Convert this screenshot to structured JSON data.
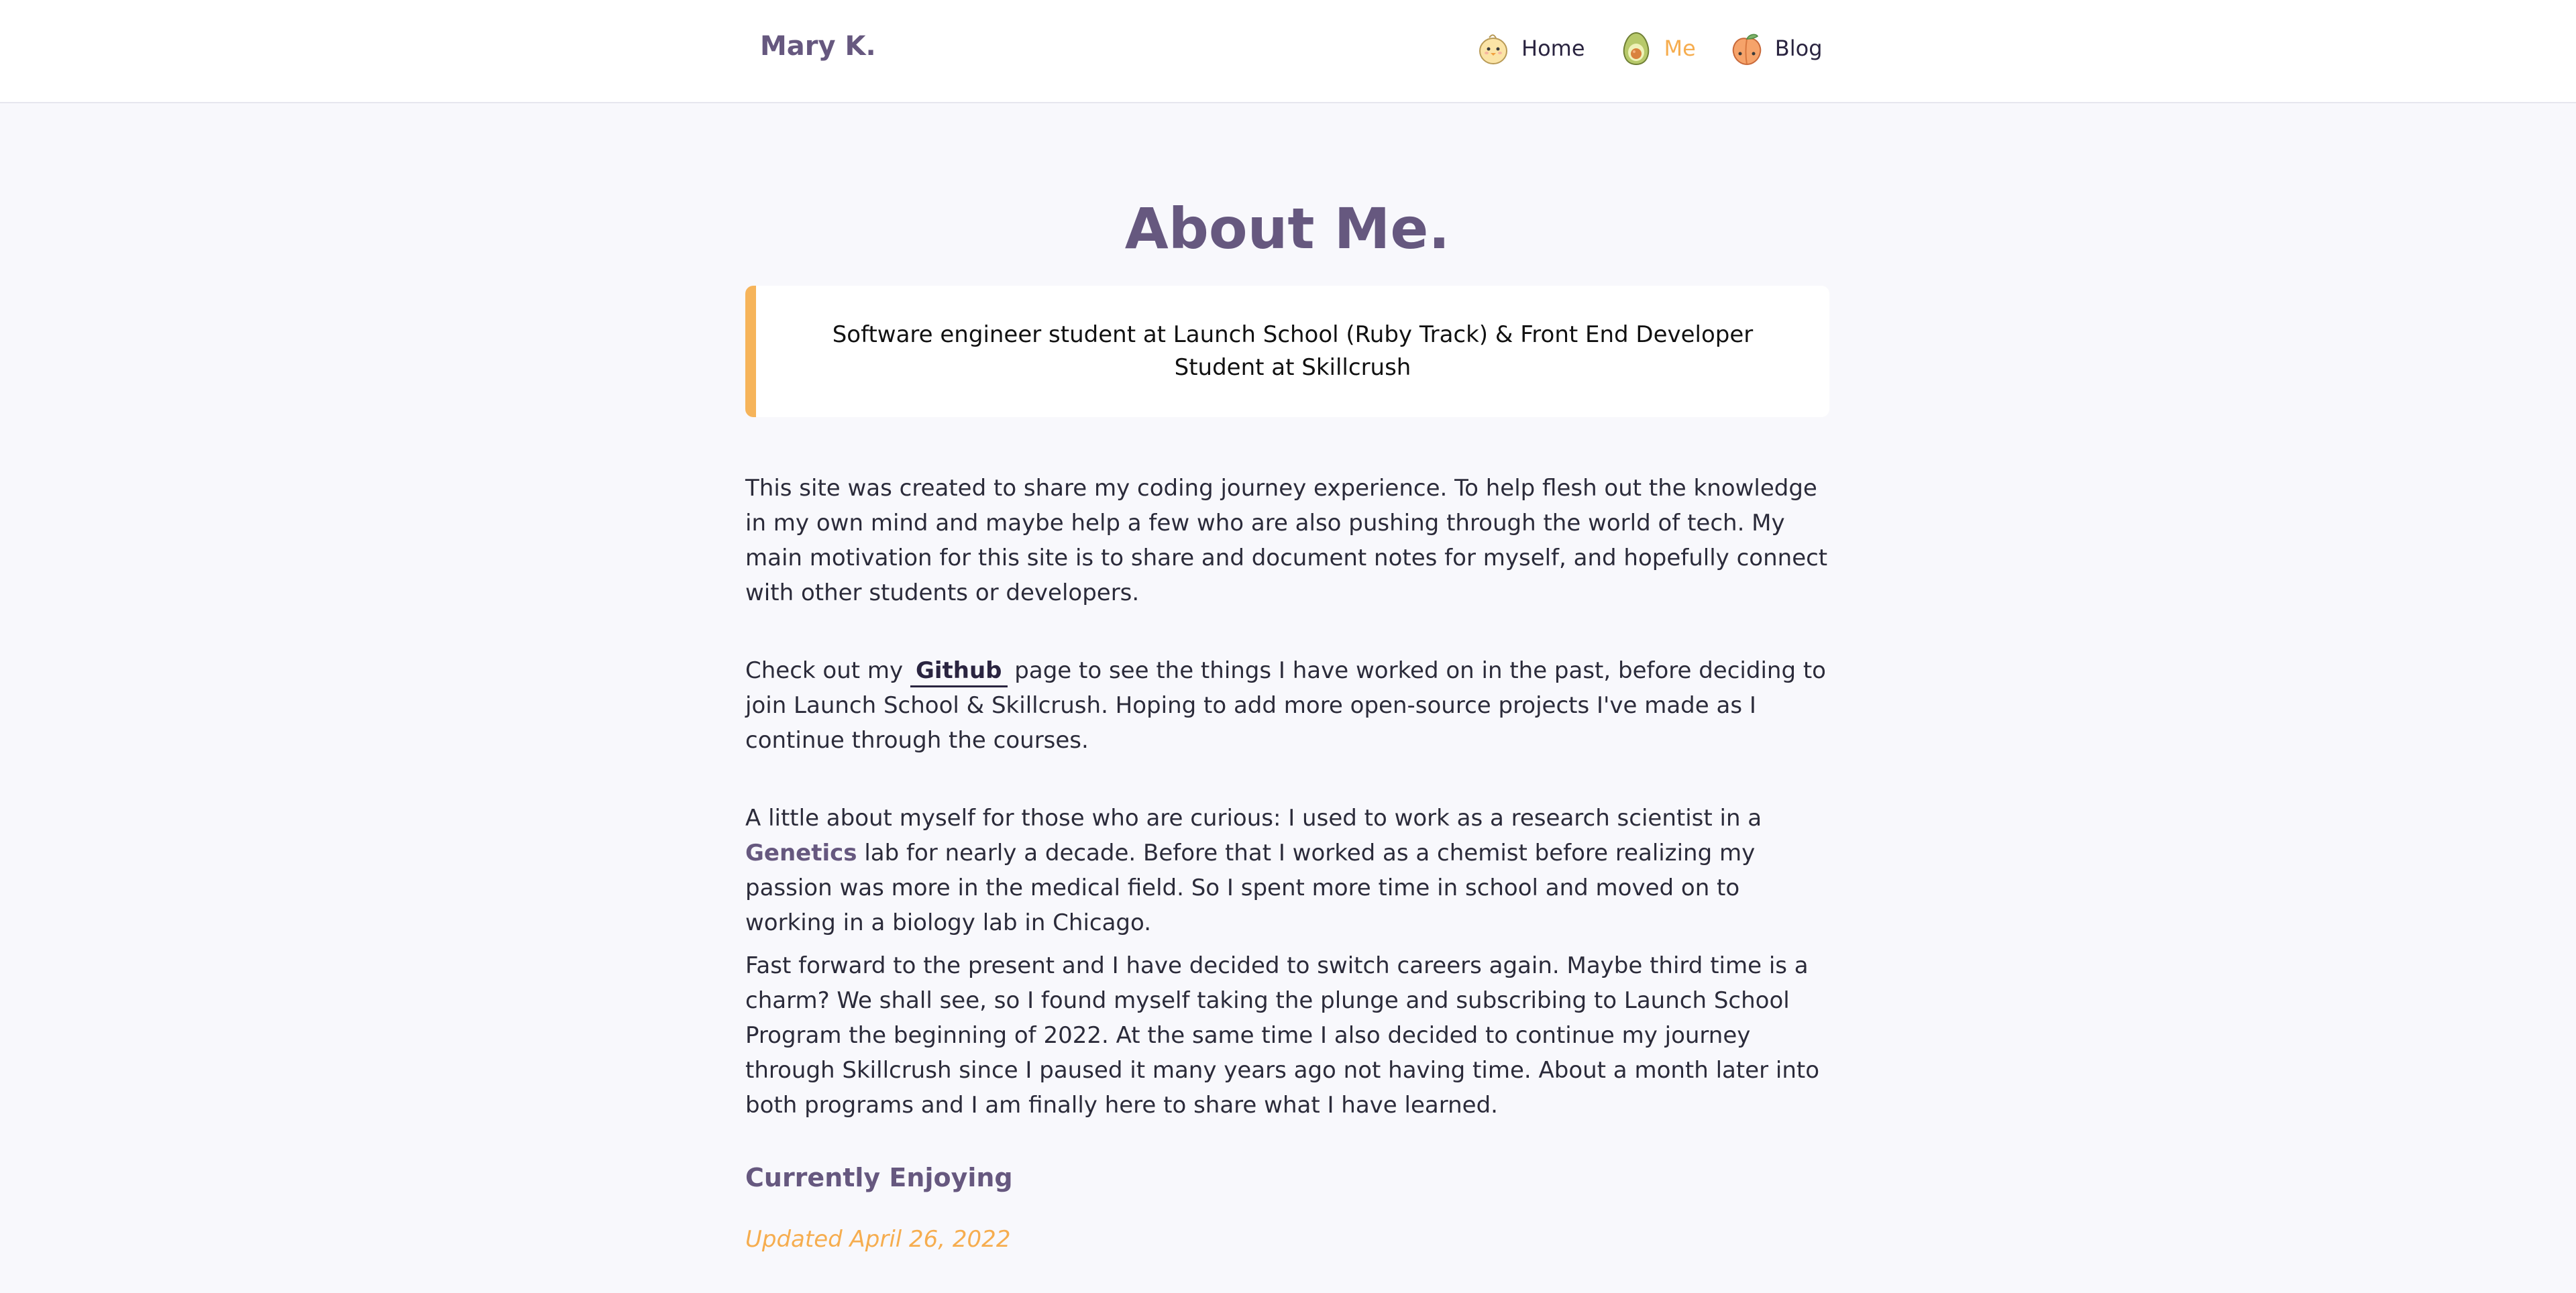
{
  "header": {
    "brand": "Mary K.",
    "nav": [
      {
        "label": "Home",
        "icon": "chick-icon",
        "active": false
      },
      {
        "label": "Me",
        "icon": "avocado-icon",
        "active": true
      },
      {
        "label": "Blog",
        "icon": "peach-icon",
        "active": false
      }
    ]
  },
  "main": {
    "title": "About Me.",
    "callout": "Software engineer student at Launch School (Ruby Track) & Front End Developer Student at Skillcrush",
    "paragraph1": "This site was created to share my coding journey experience. To help flesh out the knowledge in my own mind and maybe help a few who are also pushing through the world of tech. My main motivation for this site is to share and document notes for myself, and hopefully connect with other students or developers.",
    "paragraph2": {
      "before": "Check out my ",
      "link": "Github",
      "after": " page to see the things I have worked on in the past, before deciding to join Launch School & Skillcrush. Hoping to add more open-source projects I've made as I continue through the courses."
    },
    "paragraph3": {
      "before": "A little about myself for those who are curious: I used to work as a research scientist in a ",
      "strong": "Genetics",
      "after": " lab for nearly a decade. Before that I worked as a chemist before realizing my passion was more in the medical field. So I spent more time in school and moved on to working in a biology lab in Chicago."
    },
    "paragraph4": "Fast forward to the present and I have decided to switch careers again. Maybe third time is a charm? We shall see, so I found myself taking the plunge and subscribing to Launch School Program the beginning of 2022. At the same time I also decided to continue my journey through Skillcrush since I paused it many years ago not having time. About a month later into both programs and I am finally here to share what I have learned.",
    "section_title": "Currently Enjoying",
    "updated": "Updated April 26, 2022"
  },
  "colors": {
    "accent": "#f6ad4f",
    "brand": "#66587f",
    "callout_border": "#f6b45a",
    "background": "#f8f8fc"
  }
}
